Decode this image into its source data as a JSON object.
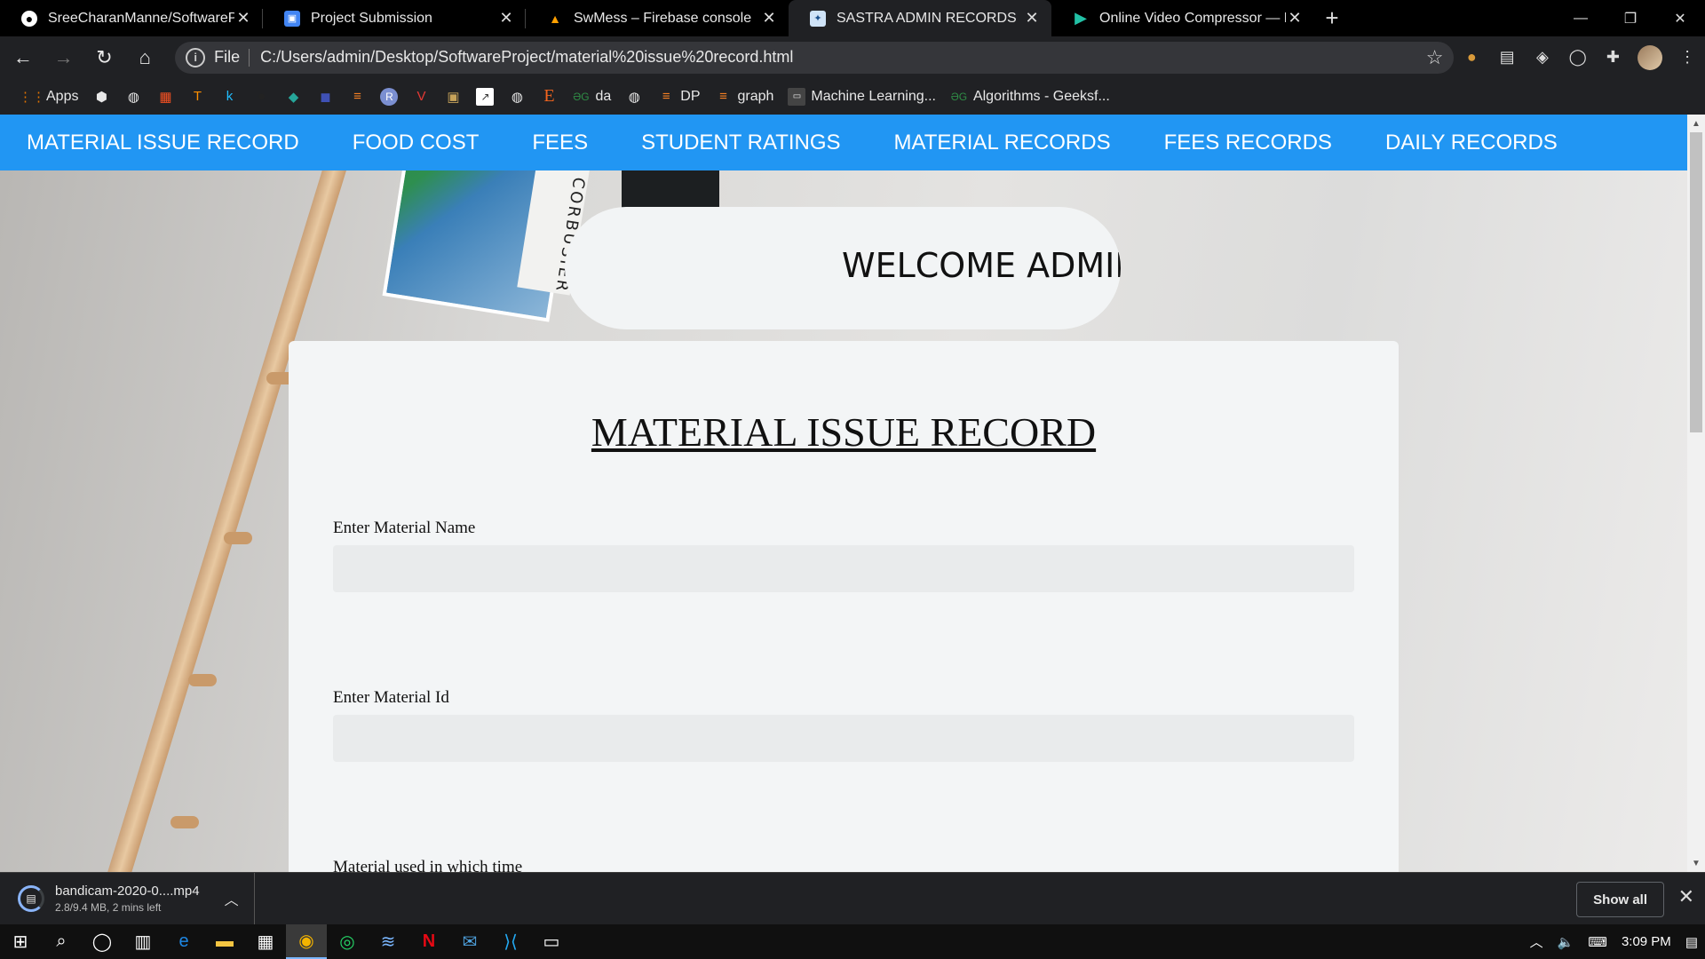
{
  "browser": {
    "tabs": [
      {
        "title": "SreeCharanManne/SoftwareProje",
        "icon": "github-icon",
        "active": false
      },
      {
        "title": "Project Submission",
        "icon": "classroom-icon",
        "active": false
      },
      {
        "title": "SwMess – Firebase console",
        "icon": "firebase-icon",
        "active": false
      },
      {
        "title": "SASTRA ADMIN RECORDS",
        "icon": "sastra-icon",
        "active": true
      },
      {
        "title": "Online Video Compressor — Red",
        "icon": "play-icon",
        "active": false
      }
    ],
    "new_tab": "+",
    "address": {
      "scheme": "File",
      "url": "C:/Users/admin/Desktop/SoftwareProject/material%20issue%20record.html"
    },
    "bookmarks": [
      {
        "label": "Apps",
        "icon": "apps-grid-icon"
      },
      {
        "label": "",
        "icon": "hatch-icon"
      },
      {
        "label": "",
        "icon": "globe-icon"
      },
      {
        "label": "",
        "icon": "microsoft-icon"
      },
      {
        "label": "",
        "icon": "tensorflow-icon"
      },
      {
        "label": "",
        "icon": "k-icon"
      },
      {
        "label": "",
        "icon": "github-icon"
      },
      {
        "label": "",
        "icon": "shield-icon"
      },
      {
        "label": "",
        "icon": "cube-icon"
      },
      {
        "label": "",
        "icon": "stackoverflow-icon"
      },
      {
        "label": "",
        "icon": "r-icon"
      },
      {
        "label": "",
        "icon": "v-icon"
      },
      {
        "label": "",
        "icon": "image-icon"
      },
      {
        "label": "",
        "icon": "chart-icon"
      },
      {
        "label": "",
        "icon": "globe-icon"
      },
      {
        "label": "",
        "icon": "etsy-icon"
      },
      {
        "label": "da",
        "icon": "geeksforgeeks-icon"
      },
      {
        "label": "",
        "icon": "globe-icon"
      },
      {
        "label": "DP",
        "icon": "stackoverflow-icon"
      },
      {
        "label": "graph",
        "icon": "stackoverflow-icon"
      },
      {
        "label": "Machine Learning...",
        "icon": "ml-icon"
      },
      {
        "label": "Algorithms - Geeksf...",
        "icon": "geeksforgeeks-icon"
      }
    ]
  },
  "page": {
    "nav": [
      "MATERIAL ISSUE RECORD",
      "FOOD COST",
      "FEES",
      "STUDENT RATINGS",
      "MATERIAL RECORDS",
      "FEES RECORDS",
      "DAILY RECORDS"
    ],
    "welcome": "WELCOME ADMIN",
    "form": {
      "title": "MATERIAL ISSUE RECORD",
      "fields": [
        {
          "label": "Enter Material Name",
          "value": ""
        },
        {
          "label": "Enter Material Id",
          "value": ""
        },
        {
          "label": "Material used in which time",
          "value": ""
        }
      ]
    },
    "background_text": "LE CORBUSIER"
  },
  "downloads": {
    "item": {
      "name": "bandicam-2020-0....mp4",
      "status": "2.8/9.4 MB, 2 mins left"
    },
    "show_all": "Show all"
  },
  "taskbar": {
    "time": "3:09 PM"
  },
  "colors": {
    "nav_bg": "#2196f3",
    "card_bg": "#f3f5f6",
    "chrome_bg": "#202124"
  }
}
